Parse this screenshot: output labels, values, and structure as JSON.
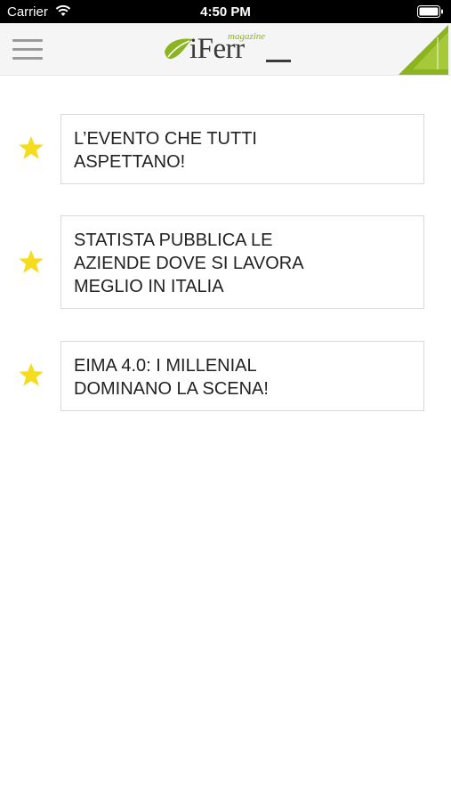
{
  "status_bar": {
    "carrier": "Carrier",
    "time": "4:50 PM",
    "wifi_icon": "wifi-icon",
    "battery_icon": "battery-icon"
  },
  "nav": {
    "menu_icon": "hamburger-menu-icon",
    "logo_text": "iFerr",
    "logo_sub": "magazine",
    "corner_icon": "green-corner-triangle-icon",
    "accent_color": "#8bb420"
  },
  "articles": [
    {
      "title": "L’EVENTO CHE TUTTI ASPETTANO!",
      "icon": "star-icon",
      "star_color": "#f5dc1e"
    },
    {
      "title": "STATISTA PUBBLICA LE AZIENDE DOVE SI LAVORA MEGLIO IN ITALIA",
      "icon": "star-icon",
      "star_color": "#f5dc1e"
    },
    {
      "title": "EIMA 4.0: I MILLENIAL DOMINANO LA SCENA!",
      "icon": "star-icon",
      "star_color": "#f5dc1e"
    }
  ]
}
